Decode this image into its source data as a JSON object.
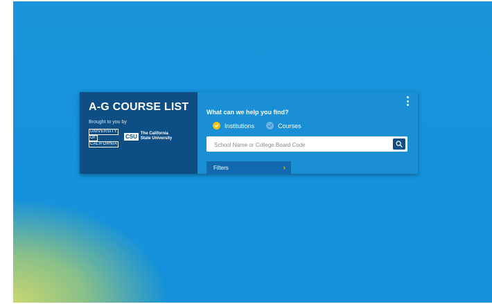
{
  "brand": {
    "title": "A-G COURSE LIST",
    "brought_by": "Brought to you by",
    "uc_lines": [
      "UNIVERSITY",
      "OF",
      "CALIFORNIA"
    ],
    "csu_mark": "CSU",
    "csu_name_line1": "The California",
    "csu_name_line2": "State University"
  },
  "search_panel": {
    "question": "What can we help you find?",
    "options": [
      {
        "label": "Institutions",
        "selected": true
      },
      {
        "label": "Courses",
        "selected": false
      }
    ],
    "search_placeholder": "School Name or College Board Code",
    "search_value": "",
    "filters_label": "Filters"
  },
  "icons": {
    "menu": "more-vertical-icon",
    "search": "search-icon",
    "check": "check-icon",
    "chevron": "chevron-right-icon"
  },
  "colors": {
    "background": "#1592dc",
    "left_panel": "#0d4f84",
    "right_panel": "#1a8fd6",
    "accent": "#f5c200"
  }
}
